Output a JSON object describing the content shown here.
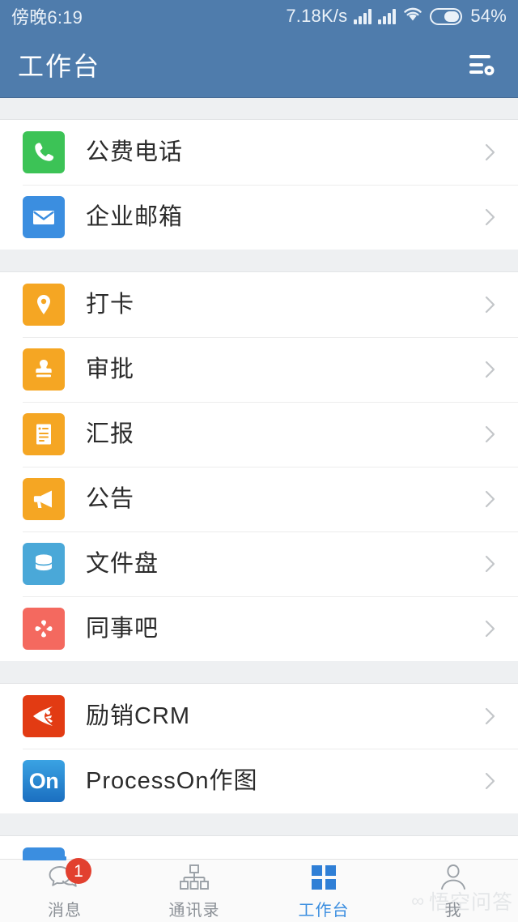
{
  "status_bar": {
    "time": "傍晚6:19",
    "network_speed": "7.18K/s",
    "battery_percent": "54%",
    "icons": [
      "signal-bars-icon",
      "signal-bars-icon",
      "wifi-icon",
      "battery-icon"
    ]
  },
  "header": {
    "title": "工作台",
    "action_icon": "list-settings-icon"
  },
  "groups": [
    {
      "items": [
        {
          "label": "公费电话",
          "icon": "phone-icon",
          "icon_bg": "#3cc356",
          "chevron": "chevron-right-icon"
        },
        {
          "label": "企业邮箱",
          "icon": "envelope-icon",
          "icon_bg": "#3b8ee0",
          "chevron": "chevron-right-icon"
        }
      ]
    },
    {
      "items": [
        {
          "label": "打卡",
          "icon": "map-pin-icon",
          "icon_bg": "#f5a623",
          "chevron": "chevron-right-icon"
        },
        {
          "label": "审批",
          "icon": "stamp-icon",
          "icon_bg": "#f5a623",
          "chevron": "chevron-right-icon"
        },
        {
          "label": "汇报",
          "icon": "document-icon",
          "icon_bg": "#f5a623",
          "chevron": "chevron-right-icon"
        },
        {
          "label": "公告",
          "icon": "megaphone-icon",
          "icon_bg": "#f5a623",
          "chevron": "chevron-right-icon"
        },
        {
          "label": "文件盘",
          "icon": "database-icon",
          "icon_bg": "#4aa8d8",
          "chevron": "chevron-right-icon"
        },
        {
          "label": "同事吧",
          "icon": "network-nodes-icon",
          "icon_bg": "#f4695f",
          "chevron": "chevron-right-icon"
        }
      ]
    },
    {
      "items": [
        {
          "label": "励销CRM",
          "icon": "crm-archer-icon",
          "icon_bg": "#e23b13",
          "chevron": "chevron-right-icon"
        },
        {
          "label": "ProcessOn作图",
          "icon": "processon-on-icon",
          "icon_bg": "#2b84cf",
          "icon_text": "On",
          "chevron": "chevron-right-icon"
        }
      ]
    },
    {
      "items": [
        {
          "label": "",
          "icon": "app-icon",
          "icon_bg": "#3b8ee0",
          "chevron": "chevron-right-icon"
        }
      ]
    }
  ],
  "bottom_nav": {
    "tabs": [
      {
        "label": "消息",
        "icon": "chat-bubbles-icon",
        "badge": "1",
        "active": false
      },
      {
        "label": "通讯录",
        "icon": "org-chart-icon",
        "badge": "",
        "active": false
      },
      {
        "label": "工作台",
        "icon": "grid-squares-icon",
        "badge": "",
        "active": true
      },
      {
        "label": "我",
        "icon": "person-icon",
        "badge": "",
        "active": false
      }
    ],
    "active_color": "#3b8ee0",
    "inactive_color": "#8b9096",
    "badge_color": "#e2402f"
  },
  "watermark": {
    "text": "悟空问答",
    "mark": "∞"
  }
}
